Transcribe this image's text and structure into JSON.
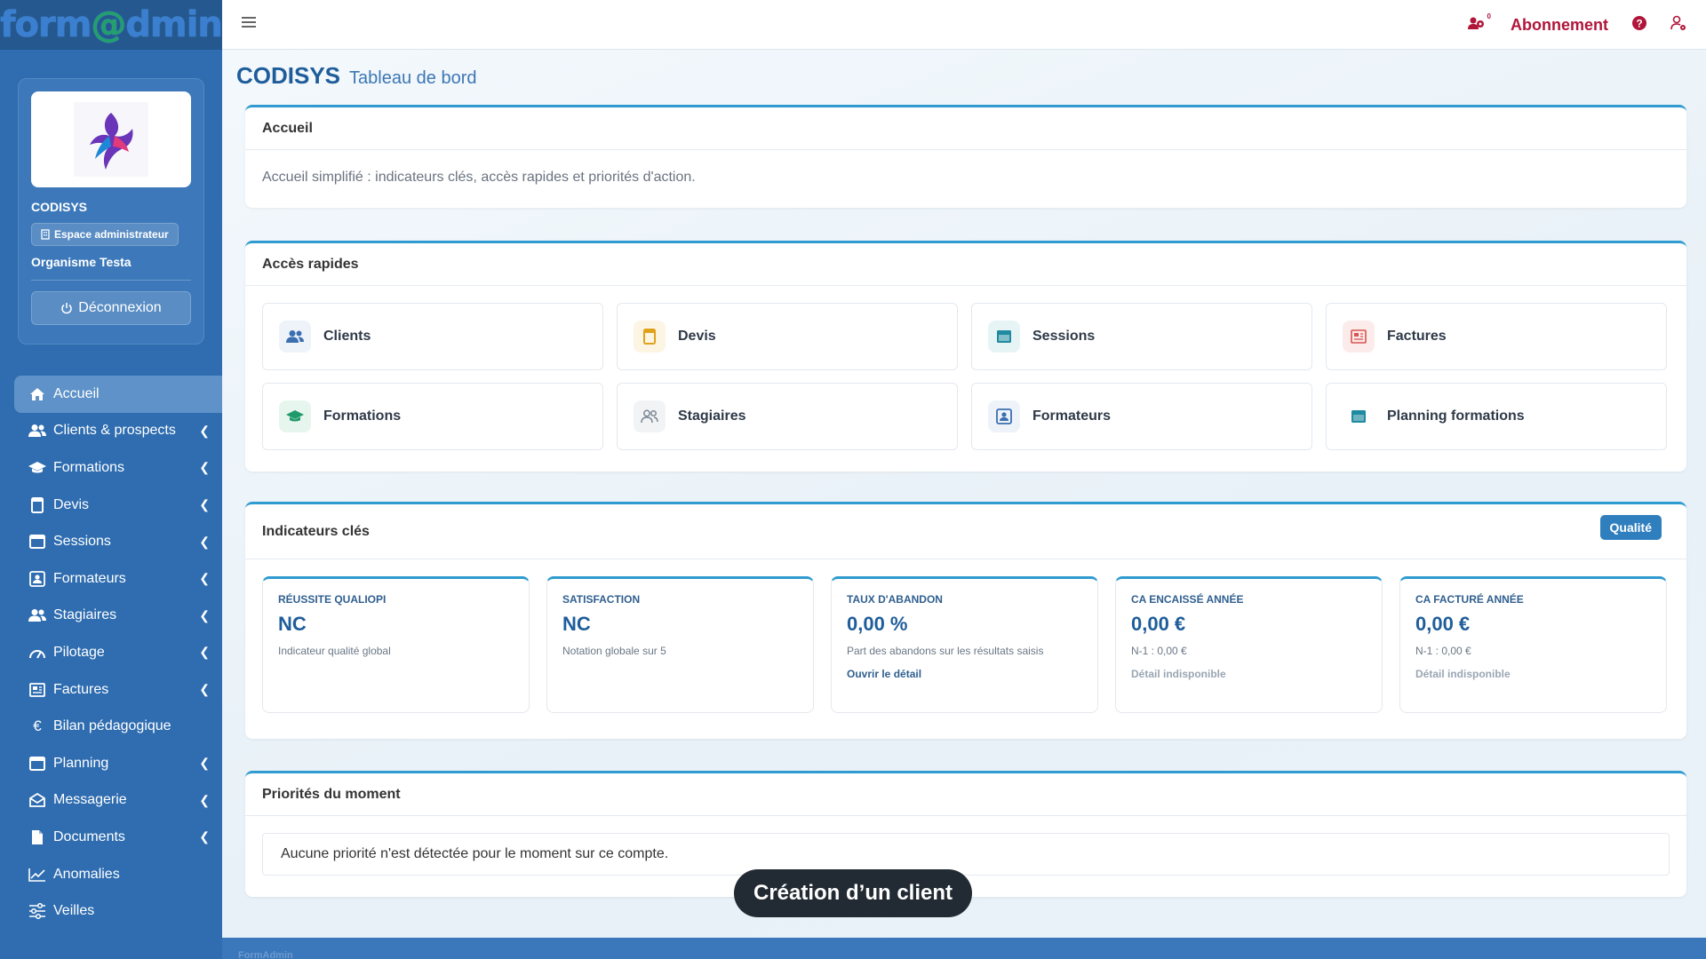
{
  "brand": {
    "part1": "form",
    "at": "@",
    "part2": "dmin"
  },
  "profile": {
    "org_name": "CODISYS",
    "admin_badge": "Espace administrateur",
    "org_sub": "Organisme Testa",
    "logout_label": "Déconnexion"
  },
  "nav": {
    "items": [
      {
        "label": "Accueil",
        "icon": "home-icon"
      },
      {
        "label": "Clients & prospects",
        "icon": "users-icon"
      },
      {
        "label": "Formations",
        "icon": "graduation-cap-icon"
      },
      {
        "label": "Devis",
        "icon": "file-icon"
      },
      {
        "label": "Sessions",
        "icon": "calendar-icon"
      },
      {
        "label": "Formateurs",
        "icon": "id-card-icon"
      },
      {
        "label": "Stagiaires",
        "icon": "users-icon"
      },
      {
        "label": "Pilotage",
        "icon": "gauge-icon"
      },
      {
        "label": "Factures",
        "icon": "newspaper-icon"
      },
      {
        "label": "Bilan pédagogique",
        "icon": "euro-icon"
      },
      {
        "label": "Planning",
        "icon": "calendar-icon"
      },
      {
        "label": "Messagerie",
        "icon": "mail-icon"
      },
      {
        "label": "Documents",
        "icon": "document-icon"
      },
      {
        "label": "Anomalies",
        "icon": "chart-line-icon"
      },
      {
        "label": "Veilles",
        "icon": "sliders-icon"
      }
    ]
  },
  "topbar": {
    "abonnement": "Abonnement",
    "notif_count": "0"
  },
  "page": {
    "title": "CODISYS",
    "subtitle": "Tableau de bord"
  },
  "accueil": {
    "title": "Accueil",
    "text": "Accueil simplifié : indicateurs clés, accès rapides et priorités d'action."
  },
  "quick_access": {
    "title": "Accès rapides",
    "tiles": [
      {
        "label": "Clients",
        "icon": "users-icon",
        "color": "#3b6fb0",
        "bg": "#eef3fa"
      },
      {
        "label": "Devis",
        "icon": "file-icon",
        "color": "#e0a21b",
        "bg": "#fdf5e4"
      },
      {
        "label": "Sessions",
        "icon": "calendar-icon",
        "color": "#1f8aa0",
        "bg": "#e7f4f6"
      },
      {
        "label": "Factures",
        "icon": "newspaper-icon",
        "color": "#d9534f",
        "bg": "#fbeceb"
      },
      {
        "label": "Formations",
        "icon": "graduation-cap-icon",
        "color": "#1f9a6a",
        "bg": "#e7f5ef"
      },
      {
        "label": "Stagiaires",
        "icon": "users-icon",
        "color": "#7a8694",
        "bg": "#f1f3f5"
      },
      {
        "label": "Formateurs",
        "icon": "id-card-icon",
        "color": "#3b6fb0",
        "bg": "#eef3fa"
      },
      {
        "label": "Planning formations",
        "icon": "calendar-icon",
        "color": "#1f8aa0",
        "bg": "#ffffff"
      }
    ]
  },
  "indicators": {
    "title": "Indicateurs clés",
    "qualite_label": "Qualité",
    "kpis": [
      {
        "title": "Réussite Qualiopi",
        "value": "NC",
        "sub": "Indicateur qualité global",
        "link": ""
      },
      {
        "title": "Satisfaction",
        "value": "NC",
        "sub": "Notation globale sur 5",
        "link": ""
      },
      {
        "title": "Taux d'abandon",
        "value": "0,00 %",
        "sub": "Part des abandons sur les résultats saisis",
        "link": "Ouvrir le détail"
      },
      {
        "title": "CA encaissé année",
        "value": "0,00 €",
        "sub": "N-1 : 0,00 €",
        "link": "Détail indisponible"
      },
      {
        "title": "CA facturé année",
        "value": "0,00 €",
        "sub": "N-1 : 0,00 €",
        "link": "Détail indisponible"
      }
    ]
  },
  "priorities": {
    "title": "Priorités du moment",
    "text": "Aucune priorité n'est détectée pour le moment sur ce compte."
  },
  "toast": {
    "text": "Création d’un client"
  },
  "footer": {
    "text": "FormAdmin"
  }
}
